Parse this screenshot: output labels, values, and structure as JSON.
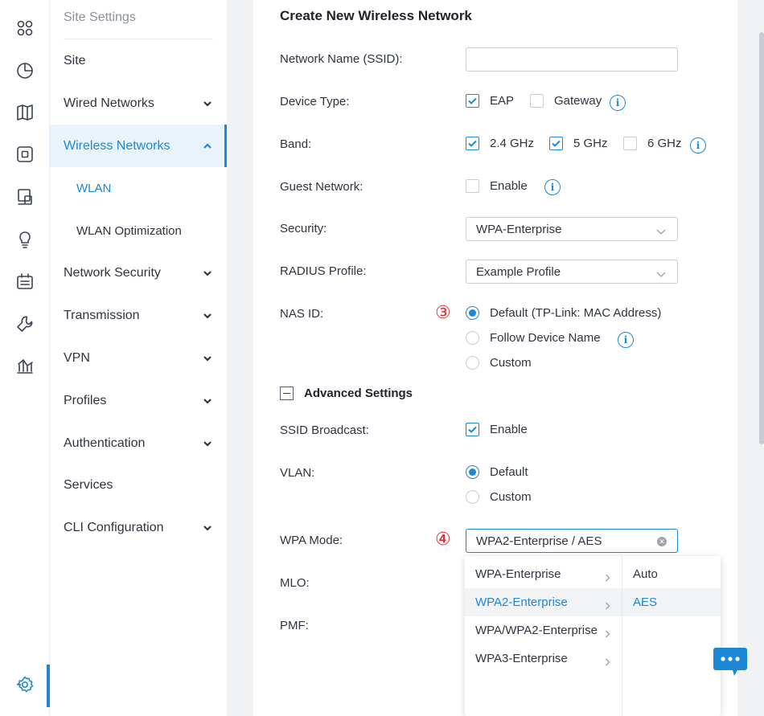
{
  "nav": {
    "title": "Site Settings",
    "items": [
      {
        "label": "Site"
      },
      {
        "label": "Wired Networks"
      },
      {
        "label": "Wireless Networks"
      },
      {
        "label": "WLAN"
      },
      {
        "label": "WLAN Optimization"
      },
      {
        "label": "Network Security"
      },
      {
        "label": "Transmission"
      },
      {
        "label": "VPN"
      },
      {
        "label": "Profiles"
      },
      {
        "label": "Authentication"
      },
      {
        "label": "Services"
      },
      {
        "label": "CLI Configuration"
      }
    ]
  },
  "rail": {
    "icons": [
      "dashboard-icon",
      "statistics-icon",
      "map-icon",
      "devices-icon",
      "clients-icon",
      "insights-icon",
      "logs-icon",
      "tools-icon",
      "reports-icon",
      "settings-icon"
    ]
  },
  "form": {
    "title": "Create New Wireless Network",
    "ssid": {
      "label": "Network Name (SSID):",
      "value": ""
    },
    "device_type": {
      "label": "Device Type:",
      "eap": "EAP",
      "gateway": "Gateway"
    },
    "band": {
      "label": "Band:",
      "b24": "2.4 GHz",
      "b5": "5 GHz",
      "b6": "6 GHz"
    },
    "guest": {
      "label": "Guest Network:",
      "enable": "Enable"
    },
    "security": {
      "label": "Security:",
      "value": "WPA-Enterprise"
    },
    "radius": {
      "label": "RADIUS Profile:",
      "value": "Example Profile"
    },
    "nas_id": {
      "label": "NAS ID:",
      "step": "③",
      "default": "Default (TP-Link: MAC Address)",
      "follow": "Follow Device Name",
      "custom": "Custom"
    },
    "advanced": {
      "label": "Advanced Settings"
    },
    "ssid_broadcast": {
      "label": "SSID Broadcast:",
      "enable": "Enable"
    },
    "vlan": {
      "label": "VLAN:",
      "default": "Default",
      "custom": "Custom"
    },
    "wpa_mode": {
      "label": "WPA Mode:",
      "step": "④",
      "value": "WPA2-Enterprise / AES"
    },
    "mlo": {
      "label": "MLO:"
    },
    "pmf": {
      "label": "PMF:"
    }
  },
  "dropdown": {
    "primary": [
      "WPA-Enterprise",
      "WPA2-Enterprise",
      "WPA/WPA2-Enterprise",
      "WPA3-Enterprise"
    ],
    "secondary": [
      "Auto",
      "AES"
    ]
  },
  "colors": {
    "accent": "#1c88d6",
    "step": "#e0262d"
  }
}
